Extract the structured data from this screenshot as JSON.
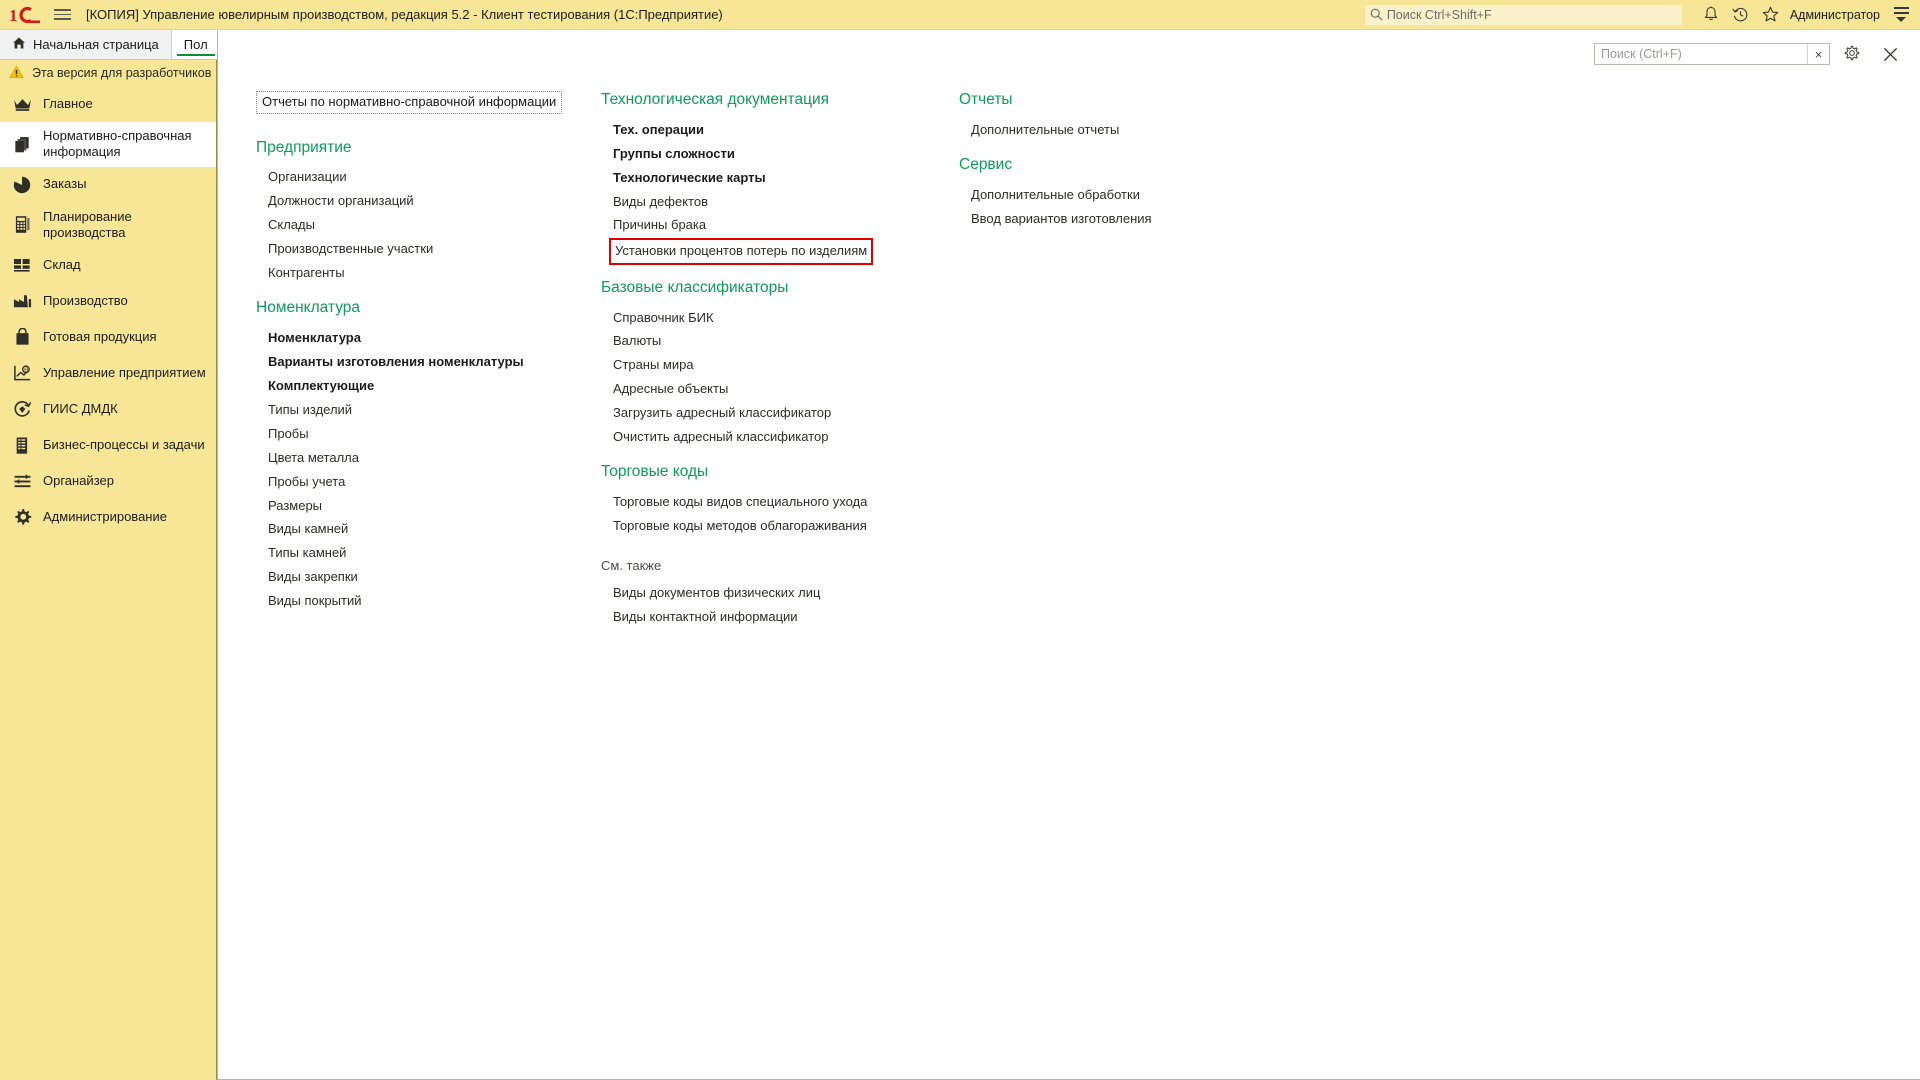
{
  "titlebar": {
    "logo": "1c-logo-icon",
    "menu_icon": "hamburger-menu-icon",
    "title": "[КОПИЯ] Управление ювелирным производством, редакция 5.2  - Клиент тестирования (1С:Предприятие)",
    "search_placeholder": "Поиск Ctrl+Shift+F",
    "search_icon": "search-icon",
    "icons": [
      "bell-icon",
      "history-clock-icon",
      "star-favorite-icon"
    ],
    "user": "Администратор",
    "more_icon": "main-menu-icon",
    "bg_color": "#f7e696"
  },
  "tabs": [
    {
      "label": "Начальная страница",
      "icon": "home-icon",
      "active": false
    },
    {
      "label": "Пол",
      "icon": "",
      "active": true
    }
  ],
  "sidebar": {
    "dev_note": "Эта версия для разработчиков",
    "dev_note_icon": "warning-triangle-icon",
    "items": [
      {
        "label": "Главное",
        "icon": "crown-icon",
        "selected": false
      },
      {
        "label": "Нормативно-справочная информация",
        "icon": "documents-stack-icon",
        "selected": true
      },
      {
        "label": "Заказы",
        "icon": "pie-chart-icon",
        "selected": false
      },
      {
        "label": "Планирование производства",
        "icon": "calculator-icon",
        "selected": false
      },
      {
        "label": "Склад",
        "icon": "grid-blocks-icon",
        "selected": false
      },
      {
        "label": "Производство",
        "icon": "factory-icon",
        "selected": false
      },
      {
        "label": "Готовая продукция",
        "icon": "bag-icon",
        "selected": false
      },
      {
        "label": "Управление предприятием",
        "icon": "chart-axis-icon",
        "selected": false
      },
      {
        "label": "ГИИС ДМДК",
        "icon": "diamond-refresh-icon",
        "selected": false
      },
      {
        "label": "Бизнес-процессы и задачи",
        "icon": "list-building-icon",
        "selected": false
      },
      {
        "label": "Органайзер",
        "icon": "sliders-icon",
        "selected": false
      },
      {
        "label": "Администрирование",
        "icon": "gear-icon",
        "selected": false
      }
    ]
  },
  "panel": {
    "search_placeholder": "Поиск (Ctrl+F)",
    "search_value": "",
    "clear_label": "×",
    "settings_icon": "gear-icon",
    "close_icon": "close-icon",
    "focus_item": "Отчеты по нормативно-справочной информации",
    "columns": [
      {
        "groups": [
          {
            "title": "Предприятие",
            "style": "green",
            "items": [
              {
                "label": "Организации",
                "bold": false,
                "highlighted": false
              },
              {
                "label": "Должности организаций",
                "bold": false,
                "highlighted": false
              },
              {
                "label": "Склады",
                "bold": false,
                "highlighted": false
              },
              {
                "label": "Производственные участки",
                "bold": false,
                "highlighted": false
              },
              {
                "label": "Контрагенты",
                "bold": false,
                "highlighted": false
              }
            ]
          },
          {
            "title": "Номенклатура",
            "style": "green",
            "items": [
              {
                "label": "Номенклатура",
                "bold": true,
                "highlighted": false
              },
              {
                "label": "Варианты изготовления номенклатуры",
                "bold": true,
                "highlighted": false
              },
              {
                "label": "Комплектующие",
                "bold": true,
                "highlighted": false
              },
              {
                "label": "Типы изделий",
                "bold": false,
                "highlighted": false
              },
              {
                "label": "Пробы",
                "bold": false,
                "highlighted": false
              },
              {
                "label": "Цвета металла",
                "bold": false,
                "highlighted": false
              },
              {
                "label": "Пробы учета",
                "bold": false,
                "highlighted": false
              },
              {
                "label": "Размеры",
                "bold": false,
                "highlighted": false
              },
              {
                "label": "Виды камней",
                "bold": false,
                "highlighted": false
              },
              {
                "label": "Типы камней",
                "bold": false,
                "highlighted": false
              },
              {
                "label": "Виды закрепки",
                "bold": false,
                "highlighted": false
              },
              {
                "label": "Виды покрытий",
                "bold": false,
                "highlighted": false
              }
            ]
          }
        ]
      },
      {
        "groups": [
          {
            "title": "Технологическая документация",
            "style": "green",
            "items": [
              {
                "label": "Тех. операции",
                "bold": true,
                "highlighted": false
              },
              {
                "label": "Группы сложности",
                "bold": true,
                "highlighted": false
              },
              {
                "label": "Технологические карты",
                "bold": true,
                "highlighted": false
              },
              {
                "label": "Виды дефектов",
                "bold": false,
                "highlighted": false
              },
              {
                "label": "Причины брака",
                "bold": false,
                "highlighted": false
              },
              {
                "label": "Установки процентов потерь по изделиям",
                "bold": false,
                "highlighted": true
              }
            ]
          },
          {
            "title": "Базовые классификаторы",
            "style": "green",
            "items": [
              {
                "label": "Справочник БИК",
                "bold": false,
                "highlighted": false
              },
              {
                "label": "Валюты",
                "bold": false,
                "highlighted": false
              },
              {
                "label": "Страны мира",
                "bold": false,
                "highlighted": false
              },
              {
                "label": "Адресные объекты",
                "bold": false,
                "highlighted": false
              },
              {
                "label": "Загрузить адресный классификатор",
                "bold": false,
                "highlighted": false
              },
              {
                "label": "Очистить адресный классификатор",
                "bold": false,
                "highlighted": false
              }
            ]
          },
          {
            "title": "Торговые коды",
            "style": "green",
            "items": [
              {
                "label": "Торговые коды видов специального ухода",
                "bold": false,
                "highlighted": false
              },
              {
                "label": "Торговые коды методов облагораживания",
                "bold": false,
                "highlighted": false
              }
            ]
          },
          {
            "title": "См. также",
            "style": "plain",
            "items": [
              {
                "label": "Виды документов физических лиц",
                "bold": false,
                "highlighted": false
              },
              {
                "label": "Виды контактной информации",
                "bold": false,
                "highlighted": false
              }
            ]
          }
        ]
      },
      {
        "groups": [
          {
            "title": "Отчеты",
            "style": "green",
            "items": [
              {
                "label": "Дополнительные отчеты",
                "bold": false,
                "highlighted": false
              }
            ]
          },
          {
            "title": "Сервис",
            "style": "green",
            "items": [
              {
                "label": "Дополнительные обработки",
                "bold": false,
                "highlighted": false
              },
              {
                "label": "Ввод вариантов изготовления",
                "bold": false,
                "highlighted": false
              }
            ]
          }
        ]
      }
    ]
  },
  "colors": {
    "accent_yellow": "#f7e696",
    "group_green": "#0e9b5b",
    "highlight_red": "#e50000",
    "tab_underline": "#0a8f3c"
  }
}
